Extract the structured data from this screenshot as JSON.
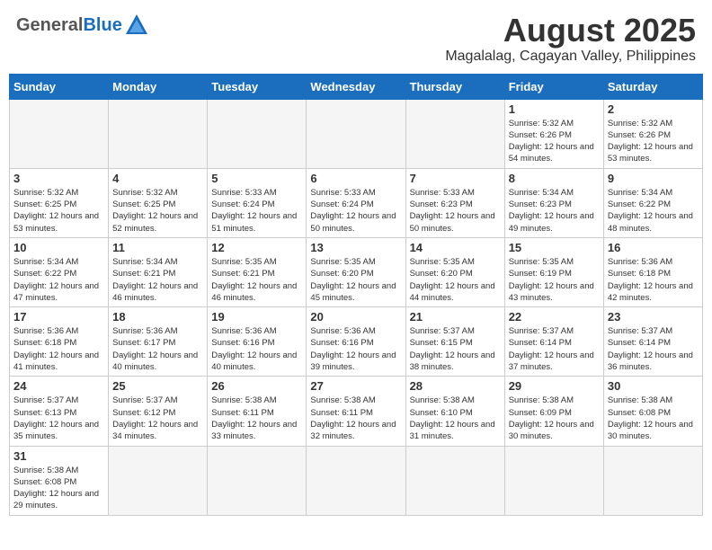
{
  "header": {
    "logo": {
      "line1": "General",
      "line2": "Blue"
    },
    "month_title": "August 2025",
    "location": "Magalalag, Cagayan Valley, Philippines"
  },
  "weekdays": [
    "Sunday",
    "Monday",
    "Tuesday",
    "Wednesday",
    "Thursday",
    "Friday",
    "Saturday"
  ],
  "weeks": [
    [
      {
        "day": "",
        "info": ""
      },
      {
        "day": "",
        "info": ""
      },
      {
        "day": "",
        "info": ""
      },
      {
        "day": "",
        "info": ""
      },
      {
        "day": "",
        "info": ""
      },
      {
        "day": "1",
        "info": "Sunrise: 5:32 AM\nSunset: 6:26 PM\nDaylight: 12 hours\nand 54 minutes."
      },
      {
        "day": "2",
        "info": "Sunrise: 5:32 AM\nSunset: 6:26 PM\nDaylight: 12 hours\nand 53 minutes."
      }
    ],
    [
      {
        "day": "3",
        "info": "Sunrise: 5:32 AM\nSunset: 6:25 PM\nDaylight: 12 hours\nand 53 minutes."
      },
      {
        "day": "4",
        "info": "Sunrise: 5:32 AM\nSunset: 6:25 PM\nDaylight: 12 hours\nand 52 minutes."
      },
      {
        "day": "5",
        "info": "Sunrise: 5:33 AM\nSunset: 6:24 PM\nDaylight: 12 hours\nand 51 minutes."
      },
      {
        "day": "6",
        "info": "Sunrise: 5:33 AM\nSunset: 6:24 PM\nDaylight: 12 hours\nand 50 minutes."
      },
      {
        "day": "7",
        "info": "Sunrise: 5:33 AM\nSunset: 6:23 PM\nDaylight: 12 hours\nand 50 minutes."
      },
      {
        "day": "8",
        "info": "Sunrise: 5:34 AM\nSunset: 6:23 PM\nDaylight: 12 hours\nand 49 minutes."
      },
      {
        "day": "9",
        "info": "Sunrise: 5:34 AM\nSunset: 6:22 PM\nDaylight: 12 hours\nand 48 minutes."
      }
    ],
    [
      {
        "day": "10",
        "info": "Sunrise: 5:34 AM\nSunset: 6:22 PM\nDaylight: 12 hours\nand 47 minutes."
      },
      {
        "day": "11",
        "info": "Sunrise: 5:34 AM\nSunset: 6:21 PM\nDaylight: 12 hours\nand 46 minutes."
      },
      {
        "day": "12",
        "info": "Sunrise: 5:35 AM\nSunset: 6:21 PM\nDaylight: 12 hours\nand 46 minutes."
      },
      {
        "day": "13",
        "info": "Sunrise: 5:35 AM\nSunset: 6:20 PM\nDaylight: 12 hours\nand 45 minutes."
      },
      {
        "day": "14",
        "info": "Sunrise: 5:35 AM\nSunset: 6:20 PM\nDaylight: 12 hours\nand 44 minutes."
      },
      {
        "day": "15",
        "info": "Sunrise: 5:35 AM\nSunset: 6:19 PM\nDaylight: 12 hours\nand 43 minutes."
      },
      {
        "day": "16",
        "info": "Sunrise: 5:36 AM\nSunset: 6:18 PM\nDaylight: 12 hours\nand 42 minutes."
      }
    ],
    [
      {
        "day": "17",
        "info": "Sunrise: 5:36 AM\nSunset: 6:18 PM\nDaylight: 12 hours\nand 41 minutes."
      },
      {
        "day": "18",
        "info": "Sunrise: 5:36 AM\nSunset: 6:17 PM\nDaylight: 12 hours\nand 40 minutes."
      },
      {
        "day": "19",
        "info": "Sunrise: 5:36 AM\nSunset: 6:16 PM\nDaylight: 12 hours\nand 40 minutes."
      },
      {
        "day": "20",
        "info": "Sunrise: 5:36 AM\nSunset: 6:16 PM\nDaylight: 12 hours\nand 39 minutes."
      },
      {
        "day": "21",
        "info": "Sunrise: 5:37 AM\nSunset: 6:15 PM\nDaylight: 12 hours\nand 38 minutes."
      },
      {
        "day": "22",
        "info": "Sunrise: 5:37 AM\nSunset: 6:14 PM\nDaylight: 12 hours\nand 37 minutes."
      },
      {
        "day": "23",
        "info": "Sunrise: 5:37 AM\nSunset: 6:14 PM\nDaylight: 12 hours\nand 36 minutes."
      }
    ],
    [
      {
        "day": "24",
        "info": "Sunrise: 5:37 AM\nSunset: 6:13 PM\nDaylight: 12 hours\nand 35 minutes."
      },
      {
        "day": "25",
        "info": "Sunrise: 5:37 AM\nSunset: 6:12 PM\nDaylight: 12 hours\nand 34 minutes."
      },
      {
        "day": "26",
        "info": "Sunrise: 5:38 AM\nSunset: 6:11 PM\nDaylight: 12 hours\nand 33 minutes."
      },
      {
        "day": "27",
        "info": "Sunrise: 5:38 AM\nSunset: 6:11 PM\nDaylight: 12 hours\nand 32 minutes."
      },
      {
        "day": "28",
        "info": "Sunrise: 5:38 AM\nSunset: 6:10 PM\nDaylight: 12 hours\nand 31 minutes."
      },
      {
        "day": "29",
        "info": "Sunrise: 5:38 AM\nSunset: 6:09 PM\nDaylight: 12 hours\nand 30 minutes."
      },
      {
        "day": "30",
        "info": "Sunrise: 5:38 AM\nSunset: 6:08 PM\nDaylight: 12 hours\nand 30 minutes."
      }
    ],
    [
      {
        "day": "31",
        "info": "Sunrise: 5:38 AM\nSunset: 6:08 PM\nDaylight: 12 hours\nand 29 minutes."
      },
      {
        "day": "",
        "info": ""
      },
      {
        "day": "",
        "info": ""
      },
      {
        "day": "",
        "info": ""
      },
      {
        "day": "",
        "info": ""
      },
      {
        "day": "",
        "info": ""
      },
      {
        "day": "",
        "info": ""
      }
    ]
  ]
}
